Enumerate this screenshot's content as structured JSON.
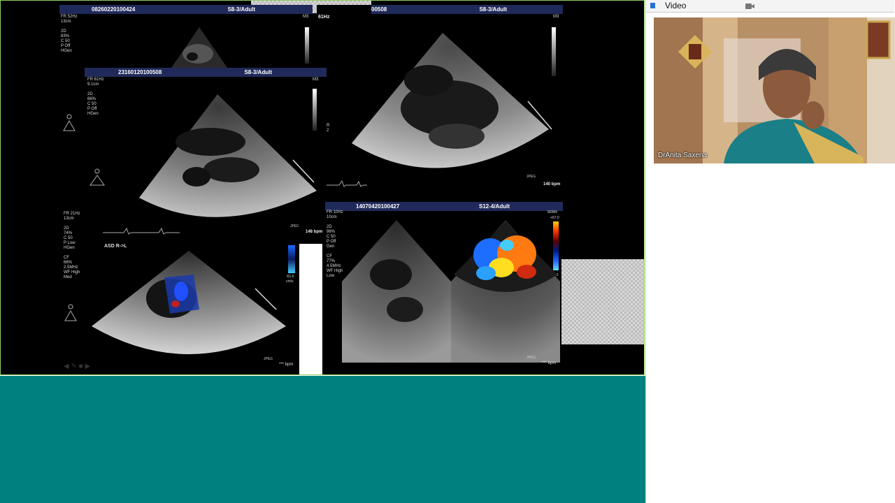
{
  "video_panel": {
    "title": "Video",
    "participant_name": "DrAnita Saxena"
  },
  "panels": {
    "p1": {
      "id": "08260220100424",
      "probe": "S8-3/Adult",
      "params": "FR 52Hz\n13cm\n\n2D\n83%\nC 50\nP Off\nHGen"
    },
    "p2": {
      "id": "23160120100508",
      "probe": "S8-3/Adult",
      "params": "FR 61Hz\n9.1cm\n\n2D\n66%\nC 50\nP Off\nHGen"
    },
    "p3": {
      "id": "00508",
      "probe": "S8-3/Adult",
      "params": "61Hz",
      "bpm": "140 bpm",
      "r_mark": "R\n2"
    },
    "p4": {
      "params": "FR 21Hz\n13cm\n\n2D\n74%\nC 50\nP Low\nHGen\n\nCF\n66%\n2.5MHz\nWF High\nMed",
      "label": "ASD R->L",
      "bpm": "148 bpm",
      "bpm2": "*** bpm",
      "scale_low": "-61.6\ncm/s"
    },
    "p5": {
      "id": "14070420100427",
      "probe": "S12-4/Adult",
      "params": "FR 10Hz\n10cm\n\n2D\n96%\nC 50\nP Off\nGen\n\nCF\n77%\n4.5MHz\nWF High\nLow",
      "scale_high": "+67.0",
      "scale_low": "-67.0\ncm/s",
      "bpm": "*** bpm",
      "mode": "M3M4"
    },
    "jpeg": "JPEG",
    "m3": "M3"
  },
  "colors": {
    "share_border": "#8fcf5f",
    "teal": "#00817f",
    "header_bg": "#202a5a"
  }
}
